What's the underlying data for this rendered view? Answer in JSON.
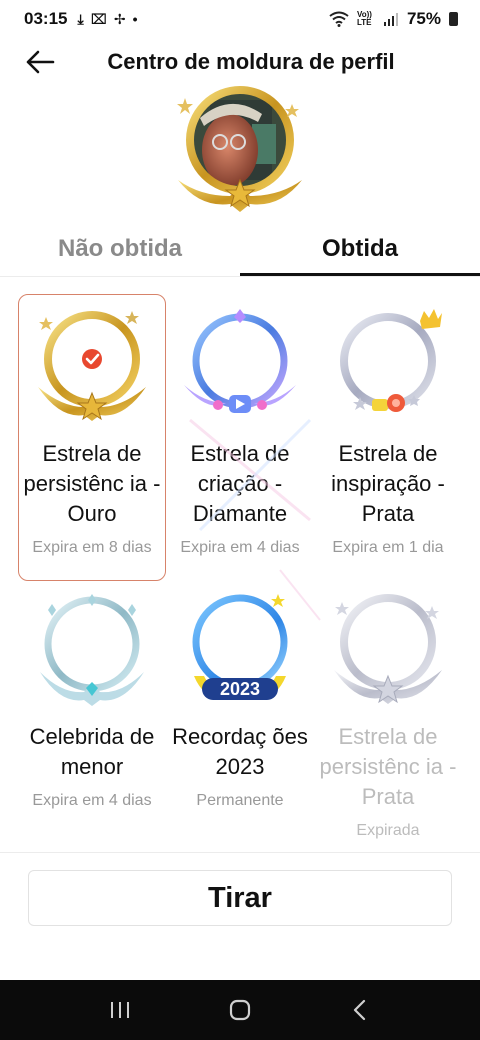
{
  "status_bar": {
    "time": "03:15",
    "network": "Vo)) LTE",
    "battery": "75%"
  },
  "header": {
    "title": "Centro de moldura de perfil"
  },
  "tabs": [
    {
      "label": "Não obtida",
      "active": false
    },
    {
      "label": "Obtida",
      "active": true
    }
  ],
  "frames": [
    {
      "name": "Estrela de persistênc ia - Ouro",
      "expiry": "Expira em 8 dias",
      "selected": true,
      "expired": false,
      "style": "gold"
    },
    {
      "name": "Estrela de criação - Diamante",
      "expiry": "Expira em 4 dias",
      "selected": false,
      "expired": false,
      "style": "diamond"
    },
    {
      "name": "Estrela de inspiração - Prata",
      "expiry": "Expira em 1 dia",
      "selected": false,
      "expired": false,
      "style": "silver-crown"
    },
    {
      "name": "Celebrida de menor",
      "expiry": "Expira em 4 dias",
      "selected": false,
      "expired": false,
      "style": "ice"
    },
    {
      "name": "Recordaç ões 2023",
      "expiry": "Permanente",
      "selected": false,
      "expired": false,
      "style": "2023"
    },
    {
      "name": "Estrela de persistênc ia - Prata",
      "expiry": "Expirada",
      "selected": false,
      "expired": true,
      "style": "silver"
    }
  ],
  "badge_2023": "2023",
  "remove_button": "Tirar",
  "colors": {
    "selected_border": "#d7836a",
    "check_badge": "#e8482f",
    "gold": "#e0b23a",
    "tab_active": "#111111",
    "tab_inactive": "#8a8a8a"
  }
}
